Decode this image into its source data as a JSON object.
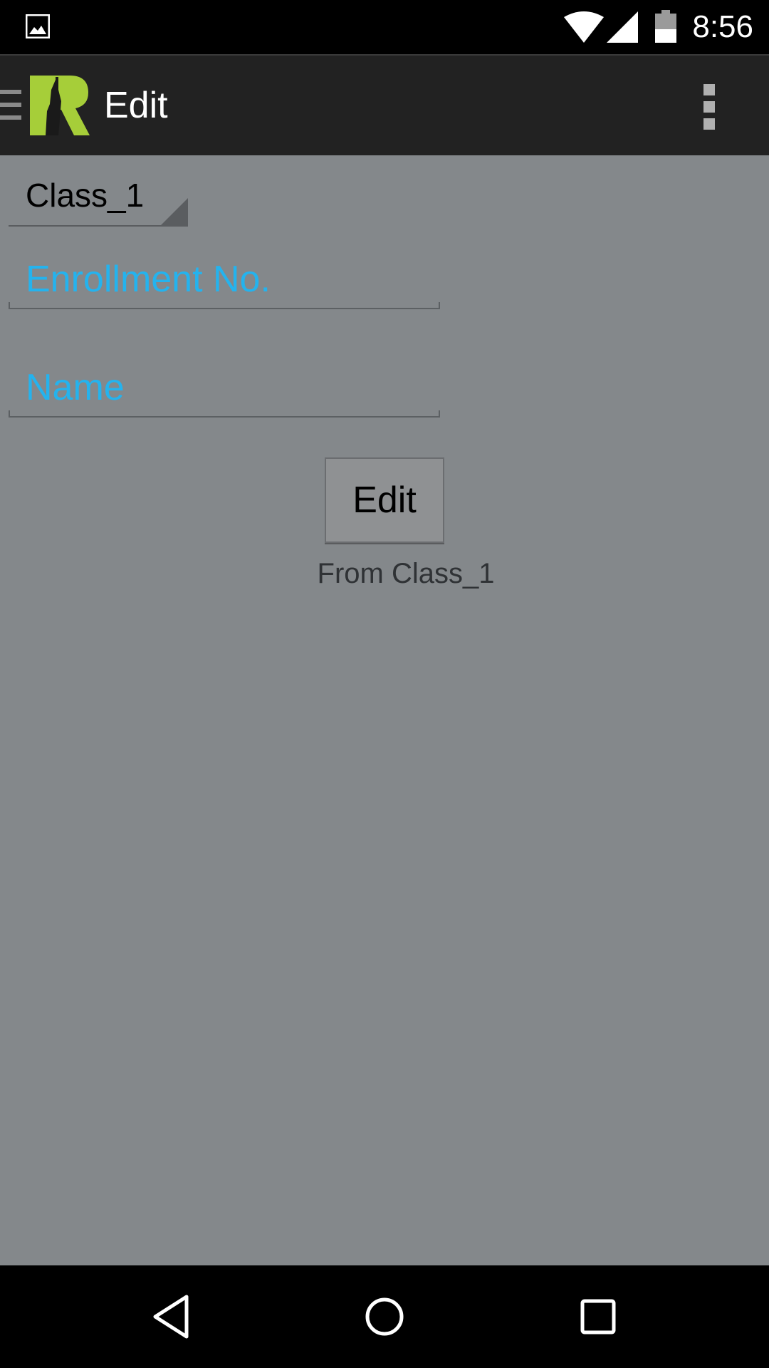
{
  "status_bar": {
    "time": "8:56",
    "icons": [
      "gallery-icon",
      "wifi-icon",
      "signal-icon",
      "battery-icon"
    ]
  },
  "action_bar": {
    "title": "Edit",
    "logo_letter": "R",
    "accent_color": "#a6ce39",
    "icons": [
      "drawer-icon",
      "overflow-menu-icon"
    ]
  },
  "form": {
    "class_spinner": {
      "selected": "Class_1"
    },
    "enrollment": {
      "placeholder": "Enrollment No.",
      "value": ""
    },
    "name": {
      "placeholder": "Name",
      "value": ""
    },
    "edit_button": {
      "label": "Edit"
    },
    "from_label": "From Class_1",
    "hint_color": "#24b3ee"
  },
  "nav_bar": {
    "icons": [
      "back-icon",
      "home-icon",
      "recents-icon"
    ]
  }
}
